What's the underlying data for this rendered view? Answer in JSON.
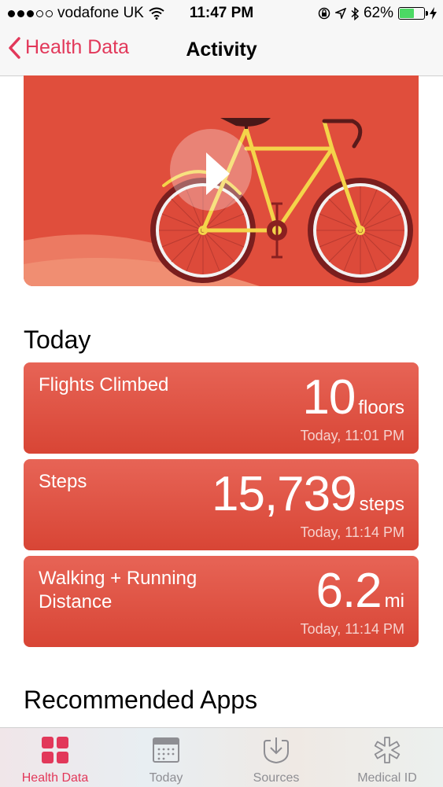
{
  "status_bar": {
    "carrier": "vodafone UK",
    "time": "11:47 PM",
    "battery": "62%",
    "battery_level": 0.62,
    "icons": [
      "signal-dots",
      "wifi-icon",
      "lock-rotation-icon",
      "location-icon",
      "bluetooth-icon",
      "battery-icon",
      "charging-icon"
    ]
  },
  "nav": {
    "back_label": "Health Data",
    "title": "Activity"
  },
  "hero": {
    "play_icon": "play-icon",
    "illustration": "bicycle-illustration"
  },
  "sections": {
    "today": "Today",
    "recommended": "Recommended Apps"
  },
  "cards": [
    {
      "label": "Flights Climbed",
      "value": "10",
      "unit": "floors",
      "date": "Today, 11:01 PM"
    },
    {
      "label": "Steps",
      "value": "15,739",
      "unit": "steps",
      "date": "Today, 11:14 PM"
    },
    {
      "label": "Walking + Running Distance",
      "value": "6.2",
      "unit": "mi",
      "date": "Today, 11:14 PM"
    }
  ],
  "tab_bar": {
    "tabs": [
      {
        "label": "Health Data",
        "icon": "grid-icon",
        "active": true
      },
      {
        "label": "Today",
        "icon": "calendar-icon",
        "active": false
      },
      {
        "label": "Sources",
        "icon": "download-heart-icon",
        "active": false
      },
      {
        "label": "Medical ID",
        "icon": "asterisk-icon",
        "active": false
      }
    ]
  },
  "colors": {
    "accent": "#e2385a",
    "card": "#e05447",
    "hero_bg": "#e04e3c",
    "tab_inactive": "#8e8e93"
  }
}
